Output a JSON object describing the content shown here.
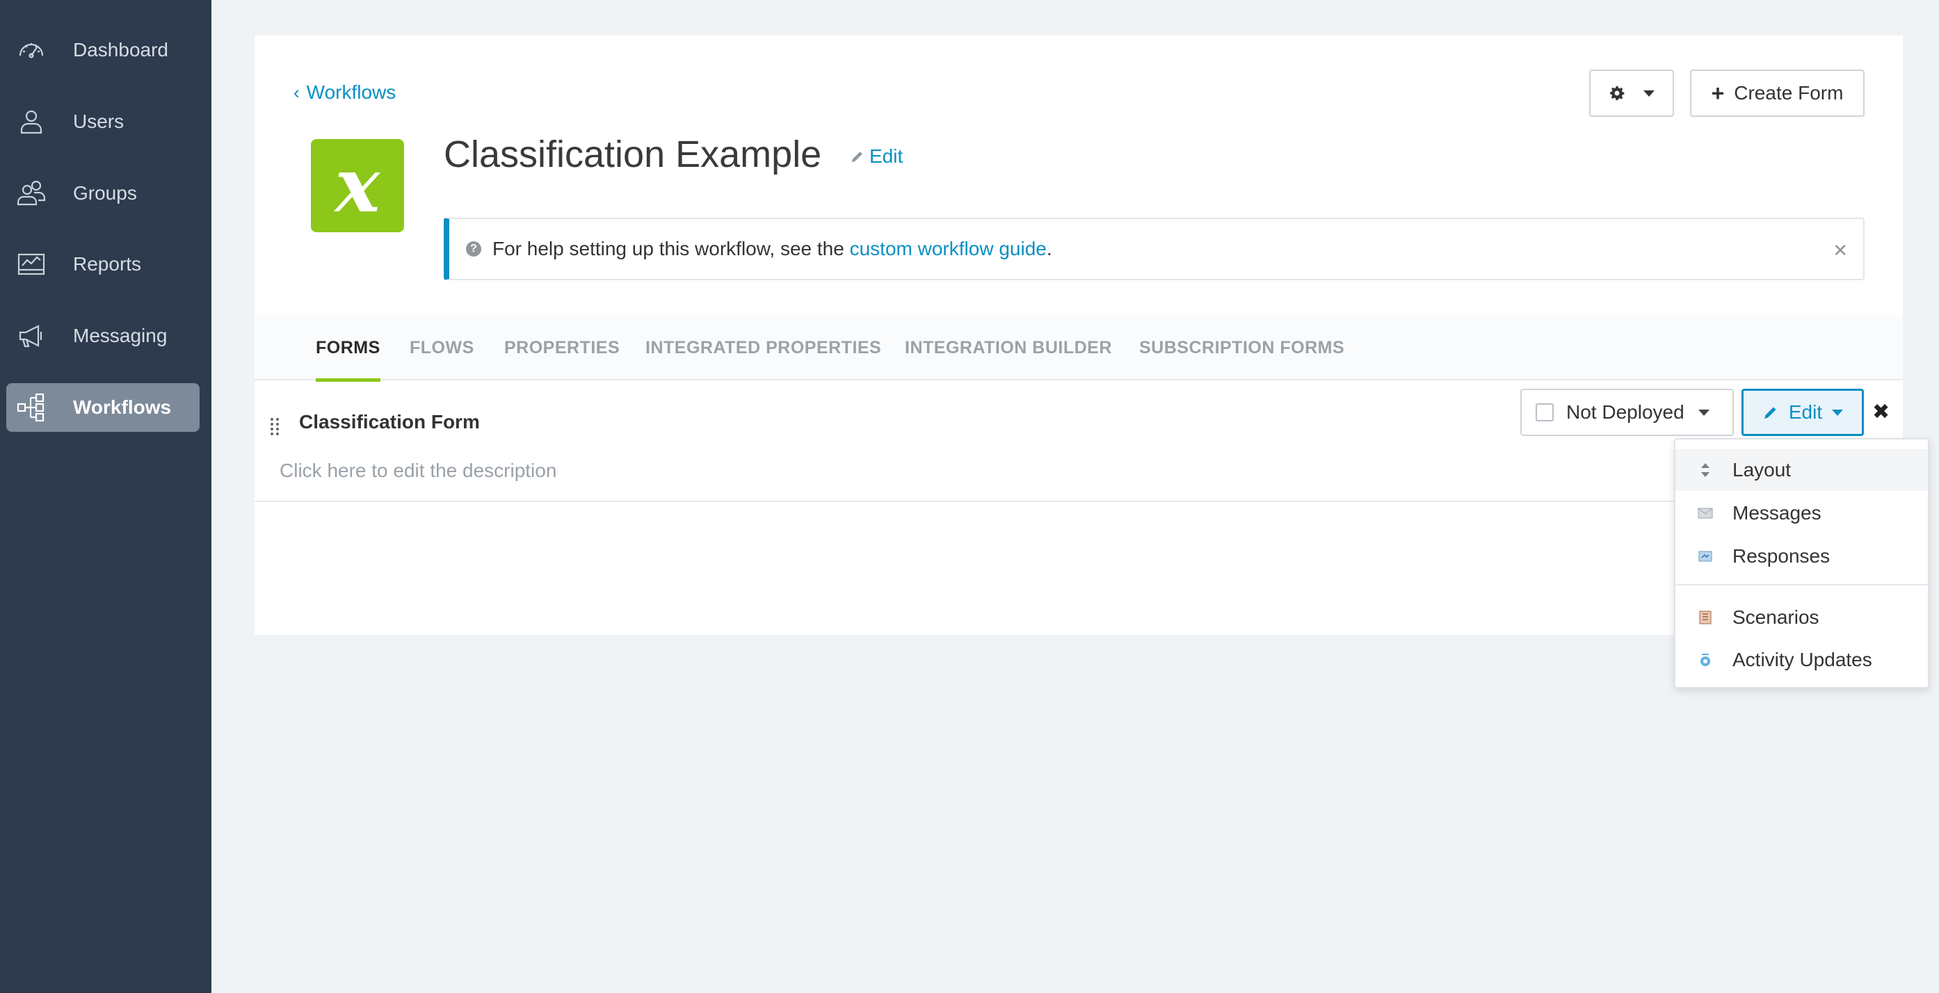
{
  "sidebar": {
    "items": [
      {
        "label": "Dashboard",
        "icon": "speedometer-icon",
        "active": false
      },
      {
        "label": "Users",
        "icon": "user-icon",
        "active": false
      },
      {
        "label": "Groups",
        "icon": "users-group-icon",
        "active": false
      },
      {
        "label": "Reports",
        "icon": "chart-icon",
        "active": false
      },
      {
        "label": "Messaging",
        "icon": "megaphone-icon",
        "active": false
      },
      {
        "label": "Workflows",
        "icon": "workflow-icon",
        "active": true
      }
    ]
  },
  "header": {
    "back_link": "Workflows",
    "title": "Classification Example",
    "title_edit": "Edit",
    "logo_letter": "x",
    "logo_color": "#8cc71a",
    "create_form": "Create Form"
  },
  "help": {
    "prefix": "For help setting up this workflow, see the ",
    "link": "custom workflow guide",
    "suffix": "."
  },
  "tabs": [
    {
      "label": "FORMS",
      "active": true
    },
    {
      "label": "FLOWS",
      "active": false
    },
    {
      "label": "PROPERTIES",
      "active": false
    },
    {
      "label": "INTEGRATED PROPERTIES",
      "active": false
    },
    {
      "label": "INTEGRATION BUILDER",
      "active": false
    },
    {
      "label": "SUBSCRIPTION FORMS",
      "active": false
    }
  ],
  "form": {
    "title": "Classification Form",
    "description_placeholder": "Click here to edit the description",
    "deploy_status": "Not Deployed",
    "edit_label": "Edit"
  },
  "edit_menu": {
    "items": [
      {
        "label": "Layout",
        "icon": "layout-icon"
      },
      {
        "label": "Messages",
        "icon": "envelope-icon"
      },
      {
        "label": "Responses",
        "icon": "responses-icon"
      },
      {
        "label": "Scenarios",
        "icon": "scenarios-icon"
      },
      {
        "label": "Activity Updates",
        "icon": "activity-updates-icon"
      }
    ]
  },
  "colors": {
    "sidebar_bg": "#2e3b4e",
    "accent_blue": "#0a8fc4",
    "accent_green": "#8cc71a"
  }
}
